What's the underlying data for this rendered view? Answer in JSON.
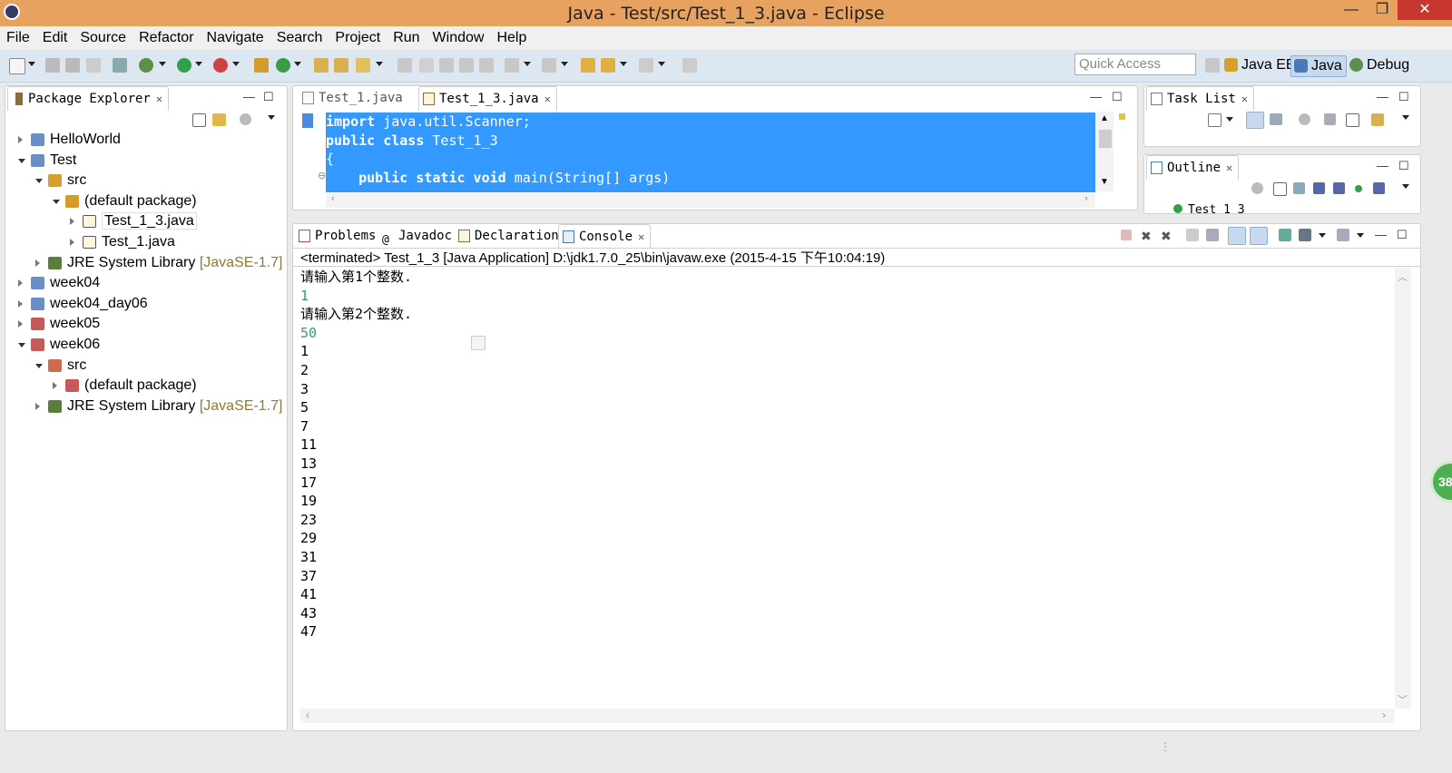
{
  "window": {
    "title": "Java - Test/src/Test_1_3.java - Eclipse",
    "min": "—",
    "max": "❐",
    "close": "✕"
  },
  "menu": [
    "File",
    "Edit",
    "Source",
    "Refactor",
    "Navigate",
    "Search",
    "Project",
    "Run",
    "Window",
    "Help"
  ],
  "toolbar": {
    "quick_access_placeholder": "Quick Access",
    "perspectives": [
      "Java EE",
      "Java",
      "Debug"
    ],
    "active_perspective": "Java"
  },
  "package_explorer": {
    "title": "Package Explorer",
    "tree": [
      {
        "label": "HelloWorld",
        "indent": 0,
        "twisty": "closed",
        "icon": "project-icon"
      },
      {
        "label": "Test",
        "indent": 0,
        "twisty": "open",
        "icon": "project-icon"
      },
      {
        "label": "src",
        "indent": 1,
        "twisty": "open",
        "icon": "source-folder-icon"
      },
      {
        "label": "(default package)",
        "indent": 2,
        "twisty": "open",
        "icon": "package-icon"
      },
      {
        "label": "Test_1_3.java",
        "indent": 3,
        "twisty": "closed",
        "icon": "java-file-icon"
      },
      {
        "label": "Test_1.java",
        "indent": 3,
        "twisty": "closed",
        "icon": "java-file-icon"
      },
      {
        "label": "JRE System Library",
        "suffix": "[JavaSE-1.7]",
        "indent": 1,
        "twisty": "closed",
        "icon": "library-icon"
      },
      {
        "label": "week04",
        "indent": 0,
        "twisty": "closed",
        "icon": "project-icon"
      },
      {
        "label": "week04_day06",
        "indent": 0,
        "twisty": "closed",
        "icon": "project-icon"
      },
      {
        "label": "week05",
        "indent": 0,
        "twisty": "closed",
        "icon": "project-error-icon"
      },
      {
        "label": "week06",
        "indent": 0,
        "twisty": "open",
        "icon": "project-error-icon"
      },
      {
        "label": "src",
        "indent": 1,
        "twisty": "open",
        "icon": "source-folder-error-icon"
      },
      {
        "label": "(default package)",
        "indent": 2,
        "twisty": "closed",
        "icon": "package-error-icon"
      },
      {
        "label": "JRE System Library",
        "suffix": "[JavaSE-1.7]",
        "indent": 1,
        "twisty": "closed",
        "icon": "library-icon"
      }
    ]
  },
  "editor": {
    "tabs": [
      "Test_1.java",
      "Test_1_3.java"
    ],
    "active_tab": "Test_1_3.java",
    "code": {
      "l1_kw": "import",
      "l1_rest": " java.util.Scanner;",
      "l2_kw": "public class",
      "l2_rest": " Test_1_3",
      "l3": "{",
      "l4_indent": "    ",
      "l4_kw": "public static void",
      "l4_rest": " main(String[] args)"
    }
  },
  "task_list": {
    "title": "Task List"
  },
  "outline": {
    "title": "Outline",
    "item": "Test_1_3"
  },
  "bottom_tabs": [
    "Problems",
    "Javadoc",
    "Declaration",
    "Console"
  ],
  "active_bottom_tab": "Console",
  "console": {
    "header": "<terminated> Test_1_3 [Java Application] D:\\jdk1.7.0_25\\bin\\javaw.exe (2015-4-15 下午10:04:19)",
    "lines": [
      {
        "text": "请输入第1个整数.",
        "input": false
      },
      {
        "text": "1",
        "input": true
      },
      {
        "text": "请输入第2个整数.",
        "input": false
      },
      {
        "text": "50",
        "input": true
      },
      {
        "text": "1",
        "input": false
      },
      {
        "text": "2",
        "input": false
      },
      {
        "text": "3",
        "input": false
      },
      {
        "text": "5",
        "input": false
      },
      {
        "text": "7",
        "input": false
      },
      {
        "text": "11",
        "input": false
      },
      {
        "text": "13",
        "input": false
      },
      {
        "text": "17",
        "input": false
      },
      {
        "text": "19",
        "input": false
      },
      {
        "text": "23",
        "input": false
      },
      {
        "text": "29",
        "input": false
      },
      {
        "text": "31",
        "input": false
      },
      {
        "text": "37",
        "input": false
      },
      {
        "text": "41",
        "input": false
      },
      {
        "text": "43",
        "input": false
      },
      {
        "text": "47",
        "input": false
      }
    ]
  },
  "badge": "38",
  "colors": {
    "titlebar": "#e8a25f",
    "selection": "#3399ff",
    "console_input": "#27a46a",
    "library_version": "#957a28"
  }
}
